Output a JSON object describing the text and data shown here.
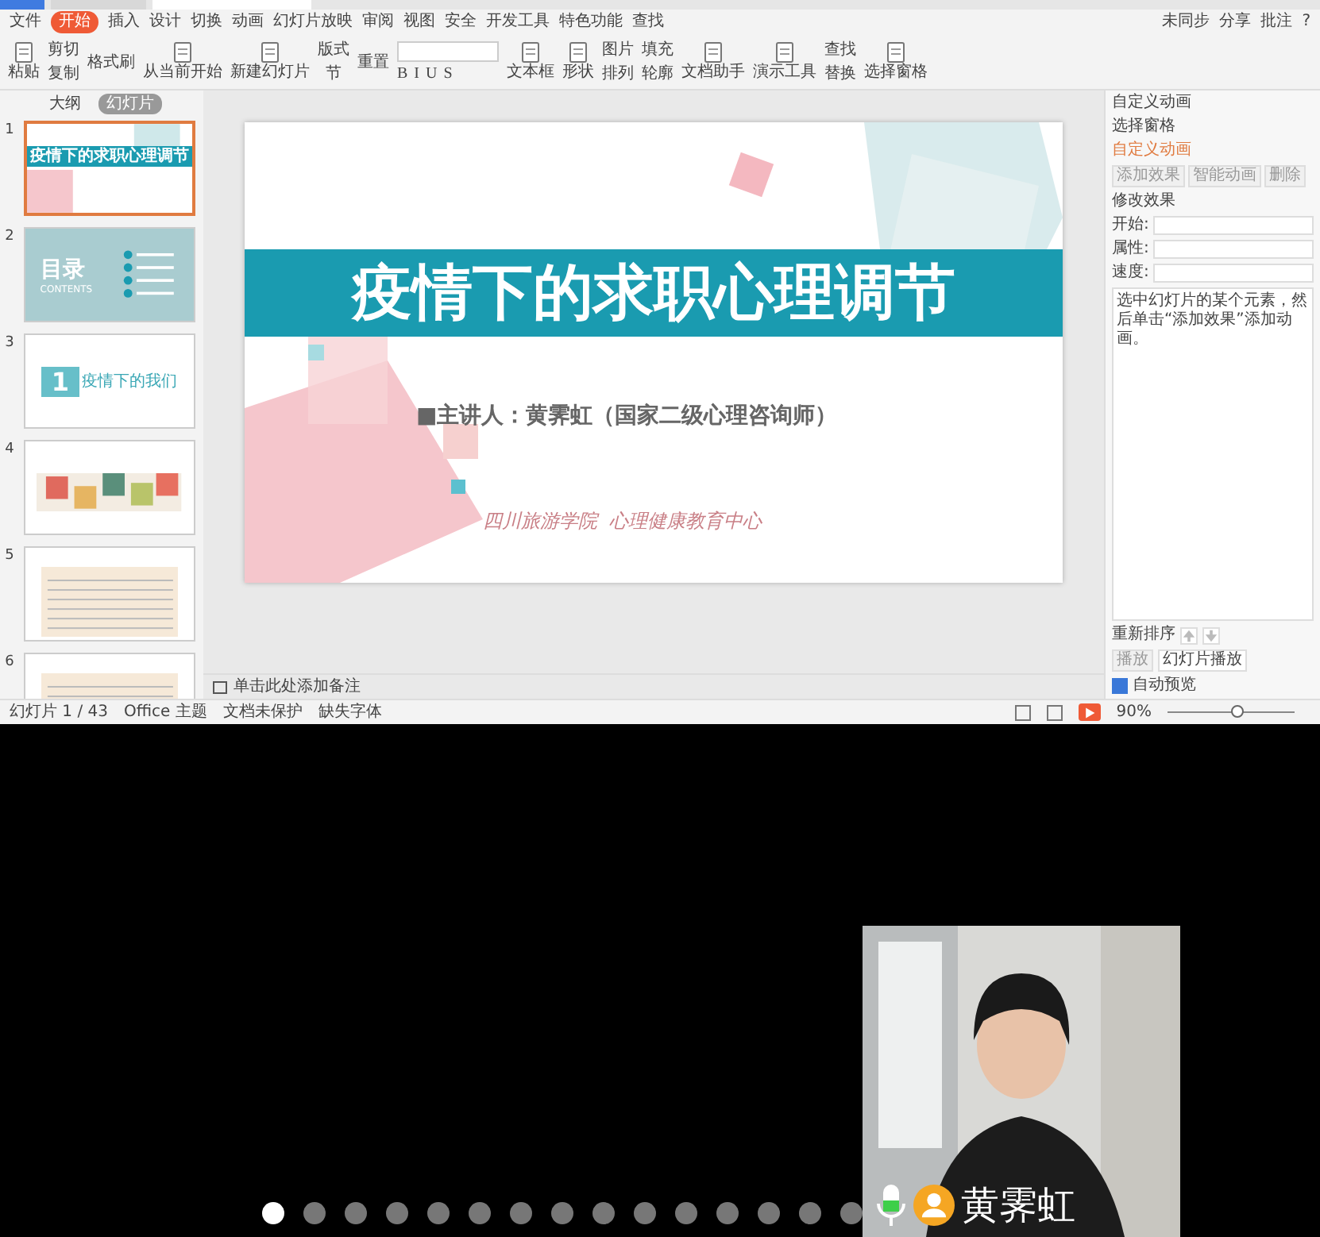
{
  "menu": {
    "file": "文件",
    "tabs": [
      {
        "label": "开始",
        "selected": true
      },
      {
        "label": "插入",
        "selected": false
      },
      {
        "label": "设计",
        "selected": false
      },
      {
        "label": "切换",
        "selected": false
      },
      {
        "label": "动画",
        "selected": false
      },
      {
        "label": "幻灯片放映",
        "selected": false
      },
      {
        "label": "审阅",
        "selected": false
      },
      {
        "label": "视图",
        "selected": false
      },
      {
        "label": "安全",
        "selected": false
      },
      {
        "label": "开发工具",
        "selected": false
      },
      {
        "label": "特色功能",
        "selected": false
      }
    ],
    "search": "查找",
    "sync": "未同步",
    "share": "分享",
    "comment": "批注",
    "help": "?"
  },
  "ribbon": [
    {
      "kind": "large",
      "label": "粘贴"
    },
    {
      "kind": "stack",
      "labels": [
        "剪切",
        "复制"
      ]
    },
    {
      "kind": "stack",
      "labels": [
        "格式刷"
      ]
    },
    {
      "kind": "large",
      "label": "从当前开始"
    },
    {
      "kind": "large",
      "label": "新建幻灯片"
    },
    {
      "kind": "stack",
      "labels": [
        "版式",
        "节"
      ]
    },
    {
      "kind": "stack",
      "labels": [
        "重置"
      ]
    },
    {
      "kind": "format",
      "keys": [
        "B",
        "I",
        "U",
        "S"
      ]
    },
    {
      "kind": "large",
      "label": "文本框"
    },
    {
      "kind": "large",
      "label": "形状"
    },
    {
      "kind": "stack",
      "labels": [
        "图片",
        "排列"
      ]
    },
    {
      "kind": "stack",
      "labels": [
        "填充",
        "轮廓"
      ]
    },
    {
      "kind": "large",
      "label": "文档助手"
    },
    {
      "kind": "large",
      "label": "演示工具"
    },
    {
      "kind": "stack",
      "labels": [
        "查找",
        "替换"
      ]
    },
    {
      "kind": "large",
      "label": "选择窗格"
    }
  ],
  "outline_tabs": [
    {
      "label": "大纲",
      "selected": false
    },
    {
      "label": "幻灯片",
      "selected": true
    }
  ],
  "thumbnails": [
    {
      "number": "1",
      "selected": true,
      "kind": "title",
      "title": "疫情下的求职心理调节"
    },
    {
      "number": "2",
      "selected": false,
      "kind": "contents",
      "title": "目录",
      "subtitle": "CONTENTS"
    },
    {
      "number": "3",
      "selected": false,
      "kind": "section",
      "badge": "1",
      "title": "疫情下的我们"
    },
    {
      "number": "4",
      "selected": false,
      "kind": "cards"
    },
    {
      "number": "5",
      "selected": false,
      "kind": "table"
    },
    {
      "number": "6",
      "selected": false,
      "kind": "table"
    }
  ],
  "slide": {
    "title": "疫情下的求职心理调节",
    "presenter": "■主讲人：黄霁虹（国家二级心理咨询师）",
    "footer": "四川旅游学院  心理健康教育中心"
  },
  "notes_placeholder": "单击此处添加备注",
  "status": [
    "幻灯片 1 / 43",
    "Office 主题",
    "文档未保护",
    "缺失字体"
  ],
  "zoom": {
    "reading": "90%",
    "level": 0.55
  },
  "pane": {
    "title": "自定义动画",
    "selection_pane": "选择窗格",
    "heading": "自定义动画",
    "buttons": [
      "添加效果",
      "智能动画",
      "删除"
    ],
    "modify": "修改效果",
    "fields": [
      "开始:",
      "属性:",
      "速度:"
    ],
    "hint": "选中幻灯片的某个元素，然后单击“添加效果”添加动画。",
    "reorder": "重新排序",
    "play": "播放",
    "slideshow": "幻灯片播放",
    "autopreview": {
      "label": "自动预览",
      "checked": true
    }
  },
  "call": {
    "pages": [
      {
        "selected": true
      },
      {
        "selected": false
      },
      {
        "selected": false
      },
      {
        "selected": false
      },
      {
        "selected": false
      },
      {
        "selected": false
      },
      {
        "selected": false
      },
      {
        "selected": false
      },
      {
        "selected": false
      },
      {
        "selected": false
      },
      {
        "selected": false
      },
      {
        "selected": false
      },
      {
        "selected": false
      },
      {
        "selected": false
      },
      {
        "selected": false
      }
    ],
    "name": "黄霁虹"
  }
}
